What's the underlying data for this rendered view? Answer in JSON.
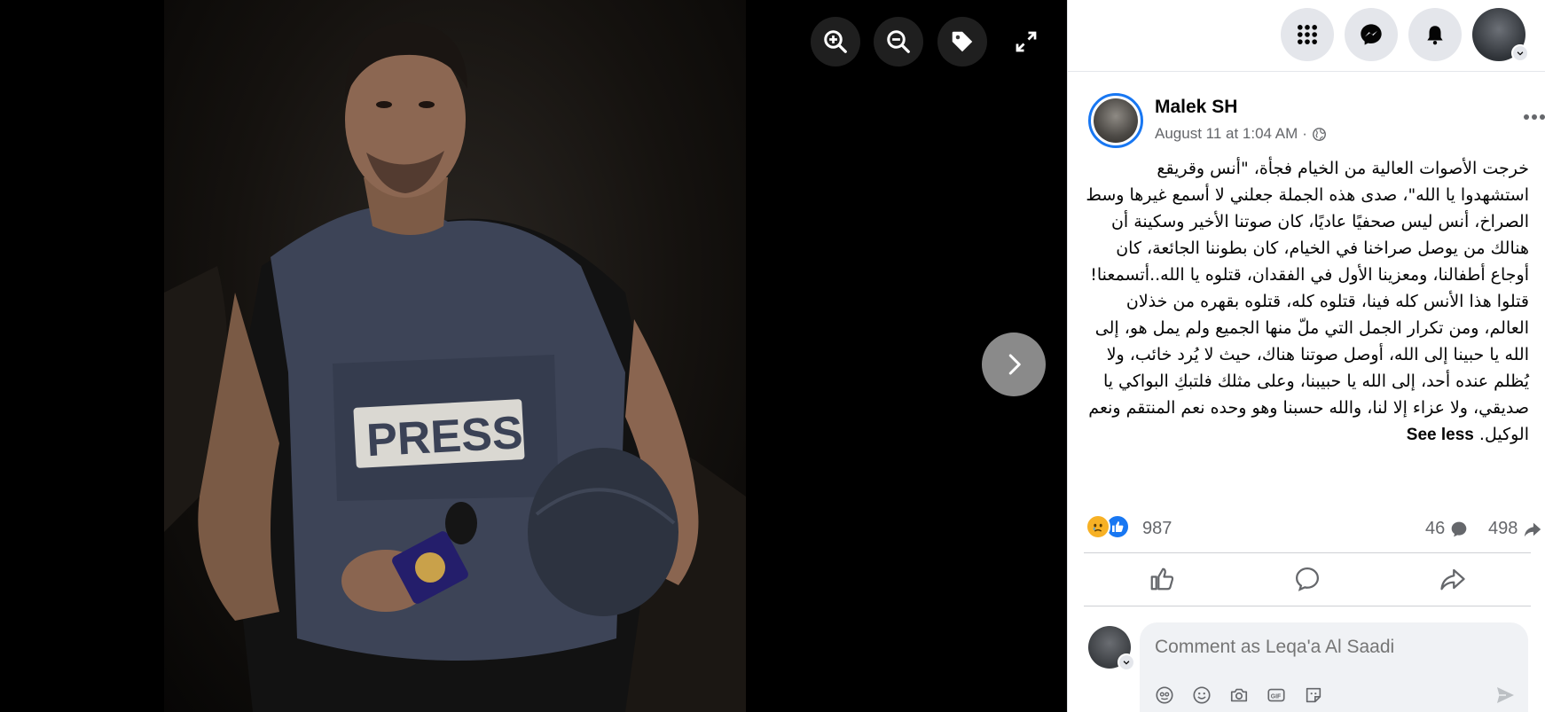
{
  "viewer": {
    "zoom_in_label": "Zoom in",
    "zoom_out_label": "Zoom out",
    "tag_label": "Tag photo",
    "fullscreen_label": "Enter full screen",
    "next_label": "Next photo",
    "vest_text": "PRESS"
  },
  "topbar": {
    "menu_icon": "grid-menu-icon",
    "messenger_icon": "messenger-icon",
    "notifications_icon": "bell-icon"
  },
  "post": {
    "author": "Malek SH",
    "timestamp": "August 11 at 1:04 AM",
    "separator": "·",
    "privacy_icon": "globe-icon",
    "text": "خرجت الأصوات العالية من الخيام فجأة، \"أنس وقريقع استشهدوا يا الله\"، صدى هذه الجملة جعلني لا أسمع غيرها وسط الصراخ، أنس ليس صحفيًا عاديًا، كان صوتنا الأخير وسكينة أن هنالك من يوصل صراخنا في الخيام، كان بطوننا الجائعة، كان أوجاع أطفالنا، ومعزينا الأول في الفقدان، قتلوه يا الله..أتسمعنا! قتلوا هذا الأنس كله فينا، قتلوه كله، قتلوه بقهره من خذلان العالم، ومن تكرار الجمل التي ملّ منها الجميع ولم يمل هو، إلى الله يا حبينا إلى الله، أوصل صوتنا هناك، حيث لا يُرد خائب، ولا يُظلم عنده أحد، إلى الله يا حبيبنا، وعلى مثلك فلتبكِ البواكي يا صديقي، ولا عزاء إلا لنا، والله حسبنا وهو وحده نعم المنتقم ونعم الوكيل.",
    "see_less": "See less",
    "reactions_count": "987",
    "comments_count": "46",
    "shares_count": "498"
  },
  "actions": {
    "like": "Like",
    "comment": "Comment",
    "share": "Share"
  },
  "comment_box": {
    "placeholder": "Comment as Leqa'a Al Saadi"
  },
  "colors": {
    "brand_blue": "#1877f2",
    "muted_text": "#65676b",
    "surface": "#f0f2f5"
  }
}
